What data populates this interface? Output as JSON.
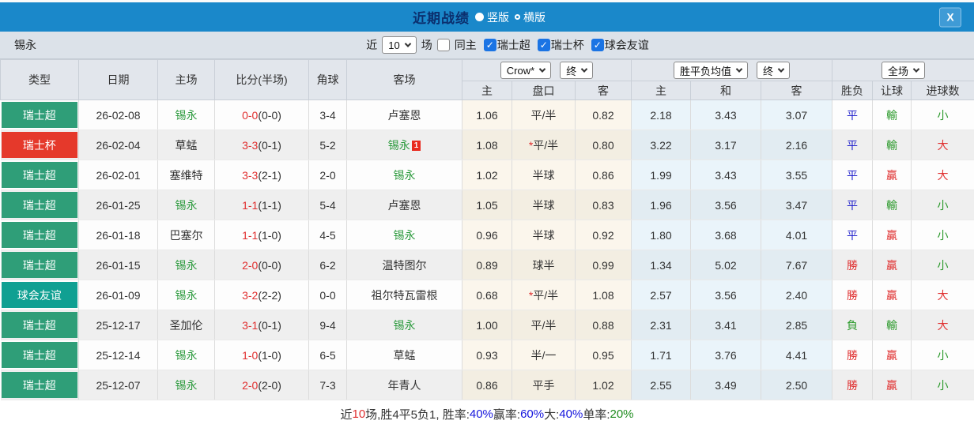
{
  "colors": {
    "topbar_bg": "#1a88ca",
    "league_super": "#2f9e78",
    "league_cup": "#e5392b",
    "league_friendly": "#10a092"
  },
  "titlebar": {
    "title": "近期战绩",
    "layout_options": [
      {
        "label": "竖版",
        "selected": true
      },
      {
        "label": "横版",
        "selected": false
      }
    ],
    "close_label": "X"
  },
  "filterbar": {
    "team": "锡永",
    "prefix": "近",
    "count_value": "10",
    "suffix": "场",
    "same_home_label": "同主",
    "league_filters": [
      {
        "label": "瑞士超",
        "checked": true
      },
      {
        "label": "瑞士杯",
        "checked": true
      },
      {
        "label": "球会友谊",
        "checked": true
      }
    ]
  },
  "table": {
    "headers": {
      "type": "类型",
      "date": "日期",
      "home": "主场",
      "score": "比分(半场)",
      "corner": "角球",
      "away": "客场",
      "crow_select": "Crow*",
      "crow_time_select": "终",
      "avg_select": "胜平负均值",
      "avg_time_select": "终",
      "scope_select": "全场",
      "sub": [
        "主",
        "盘口",
        "客",
        "主",
        "和",
        "客",
        "胜负",
        "让球",
        "进球数"
      ]
    },
    "rows": [
      {
        "type": {
          "label": "瑞士超",
          "color": "#2f9e78"
        },
        "date": "26-02-08",
        "home": {
          "name": "锡永",
          "green": true
        },
        "score": {
          "ft": "0-0",
          "ht": "(0-0)"
        },
        "corner": "3-4",
        "away": {
          "name": "卢塞恩",
          "green": false,
          "red_card": ""
        },
        "crow": {
          "home": "1.06",
          "star": false,
          "handicap": "平/半",
          "away": "0.82"
        },
        "avg": {
          "home": "2.18",
          "draw": "3.43",
          "away": "3.07"
        },
        "result": {
          "text": "平",
          "color": "blue"
        },
        "cover": {
          "text": "輸",
          "color": "green"
        },
        "goals": {
          "text": "小",
          "color": "green"
        }
      },
      {
        "type": {
          "label": "瑞士杯",
          "color": "#e5392b"
        },
        "date": "26-02-04",
        "home": {
          "name": "草蜢",
          "green": false
        },
        "score": {
          "ft": "3-3",
          "ht": "(0-1)"
        },
        "corner": "5-2",
        "away": {
          "name": "锡永",
          "green": true,
          "red_card": "1"
        },
        "crow": {
          "home": "1.08",
          "star": true,
          "handicap": "平/半",
          "away": "0.80"
        },
        "avg": {
          "home": "3.22",
          "draw": "3.17",
          "away": "2.16"
        },
        "result": {
          "text": "平",
          "color": "blue"
        },
        "cover": {
          "text": "輸",
          "color": "green"
        },
        "goals": {
          "text": "大",
          "color": "red"
        }
      },
      {
        "type": {
          "label": "瑞士超",
          "color": "#2f9e78"
        },
        "date": "26-02-01",
        "home": {
          "name": "塞维特",
          "green": false
        },
        "score": {
          "ft": "3-3",
          "ht": "(2-1)"
        },
        "corner": "2-0",
        "away": {
          "name": "锡永",
          "green": true,
          "red_card": ""
        },
        "crow": {
          "home": "1.02",
          "star": false,
          "handicap": "半球",
          "away": "0.86"
        },
        "avg": {
          "home": "1.99",
          "draw": "3.43",
          "away": "3.55"
        },
        "result": {
          "text": "平",
          "color": "blue"
        },
        "cover": {
          "text": "贏",
          "color": "red"
        },
        "goals": {
          "text": "大",
          "color": "red"
        }
      },
      {
        "type": {
          "label": "瑞士超",
          "color": "#2f9e78"
        },
        "date": "26-01-25",
        "home": {
          "name": "锡永",
          "green": true
        },
        "score": {
          "ft": "1-1",
          "ht": "(1-1)"
        },
        "corner": "5-4",
        "away": {
          "name": "卢塞恩",
          "green": false,
          "red_card": ""
        },
        "crow": {
          "home": "1.05",
          "star": false,
          "handicap": "半球",
          "away": "0.83"
        },
        "avg": {
          "home": "1.96",
          "draw": "3.56",
          "away": "3.47"
        },
        "result": {
          "text": "平",
          "color": "blue"
        },
        "cover": {
          "text": "輸",
          "color": "green"
        },
        "goals": {
          "text": "小",
          "color": "green"
        }
      },
      {
        "type": {
          "label": "瑞士超",
          "color": "#2f9e78"
        },
        "date": "26-01-18",
        "home": {
          "name": "巴塞尔",
          "green": false
        },
        "score": {
          "ft": "1-1",
          "ht": "(1-0)"
        },
        "corner": "4-5",
        "away": {
          "name": "锡永",
          "green": true,
          "red_card": ""
        },
        "crow": {
          "home": "0.96",
          "star": false,
          "handicap": "半球",
          "away": "0.92"
        },
        "avg": {
          "home": "1.80",
          "draw": "3.68",
          "away": "4.01"
        },
        "result": {
          "text": "平",
          "color": "blue"
        },
        "cover": {
          "text": "贏",
          "color": "red"
        },
        "goals": {
          "text": "小",
          "color": "green"
        }
      },
      {
        "type": {
          "label": "瑞士超",
          "color": "#2f9e78"
        },
        "date": "26-01-15",
        "home": {
          "name": "锡永",
          "green": true
        },
        "score": {
          "ft": "2-0",
          "ht": "(0-0)"
        },
        "corner": "6-2",
        "away": {
          "name": "温特图尔",
          "green": false,
          "red_card": ""
        },
        "crow": {
          "home": "0.89",
          "star": false,
          "handicap": "球半",
          "away": "0.99"
        },
        "avg": {
          "home": "1.34",
          "draw": "5.02",
          "away": "7.67"
        },
        "result": {
          "text": "勝",
          "color": "red"
        },
        "cover": {
          "text": "贏",
          "color": "red"
        },
        "goals": {
          "text": "小",
          "color": "green"
        }
      },
      {
        "type": {
          "label": "球会友谊",
          "color": "#10a092"
        },
        "date": "26-01-09",
        "home": {
          "name": "锡永",
          "green": true
        },
        "score": {
          "ft": "3-2",
          "ht": "(2-2)"
        },
        "corner": "0-0",
        "away": {
          "name": "祖尔特瓦雷根",
          "green": false,
          "red_card": ""
        },
        "crow": {
          "home": "0.68",
          "star": true,
          "handicap": "平/半",
          "away": "1.08"
        },
        "avg": {
          "home": "2.57",
          "draw": "3.56",
          "away": "2.40"
        },
        "result": {
          "text": "勝",
          "color": "red"
        },
        "cover": {
          "text": "贏",
          "color": "red"
        },
        "goals": {
          "text": "大",
          "color": "red"
        }
      },
      {
        "type": {
          "label": "瑞士超",
          "color": "#2f9e78"
        },
        "date": "25-12-17",
        "home": {
          "name": "圣加伦",
          "green": false
        },
        "score": {
          "ft": "3-1",
          "ht": "(0-1)"
        },
        "corner": "9-4",
        "away": {
          "name": "锡永",
          "green": true,
          "red_card": ""
        },
        "crow": {
          "home": "1.00",
          "star": false,
          "handicap": "平/半",
          "away": "0.88"
        },
        "avg": {
          "home": "2.31",
          "draw": "3.41",
          "away": "2.85"
        },
        "result": {
          "text": "負",
          "color": "green"
        },
        "cover": {
          "text": "輸",
          "color": "green"
        },
        "goals": {
          "text": "大",
          "color": "red"
        }
      },
      {
        "type": {
          "label": "瑞士超",
          "color": "#2f9e78"
        },
        "date": "25-12-14",
        "home": {
          "name": "锡永",
          "green": true
        },
        "score": {
          "ft": "1-0",
          "ht": "(1-0)"
        },
        "corner": "6-5",
        "away": {
          "name": "草蜢",
          "green": false,
          "red_card": ""
        },
        "crow": {
          "home": "0.93",
          "star": false,
          "handicap": "半/一",
          "away": "0.95"
        },
        "avg": {
          "home": "1.71",
          "draw": "3.76",
          "away": "4.41"
        },
        "result": {
          "text": "勝",
          "color": "red"
        },
        "cover": {
          "text": "贏",
          "color": "red"
        },
        "goals": {
          "text": "小",
          "color": "green"
        }
      },
      {
        "type": {
          "label": "瑞士超",
          "color": "#2f9e78"
        },
        "date": "25-12-07",
        "home": {
          "name": "锡永",
          "green": true
        },
        "score": {
          "ft": "2-0",
          "ht": "(2-0)"
        },
        "corner": "7-3",
        "away": {
          "name": "年青人",
          "green": false,
          "red_card": ""
        },
        "crow": {
          "home": "0.86",
          "star": false,
          "handicap": "平手",
          "away": "1.02"
        },
        "avg": {
          "home": "2.55",
          "draw": "3.49",
          "away": "2.50"
        },
        "result": {
          "text": "勝",
          "color": "red"
        },
        "cover": {
          "text": "贏",
          "color": "red"
        },
        "goals": {
          "text": "小",
          "color": "green"
        }
      }
    ]
  },
  "footer": {
    "segments": [
      {
        "text": "近",
        "color": "black"
      },
      {
        "text": "10",
        "color": "red"
      },
      {
        "text": "场,胜4平5负1, 胜率:",
        "color": "black"
      },
      {
        "text": "40%",
        "color": "fblue"
      },
      {
        "text": " 赢率:",
        "color": "black"
      },
      {
        "text": "60%",
        "color": "fblue"
      },
      {
        "text": " 大:",
        "color": "black"
      },
      {
        "text": "40%",
        "color": "fblue"
      },
      {
        "text": " 单率:",
        "color": "black"
      },
      {
        "text": "20%",
        "color": "fgreen"
      }
    ]
  }
}
